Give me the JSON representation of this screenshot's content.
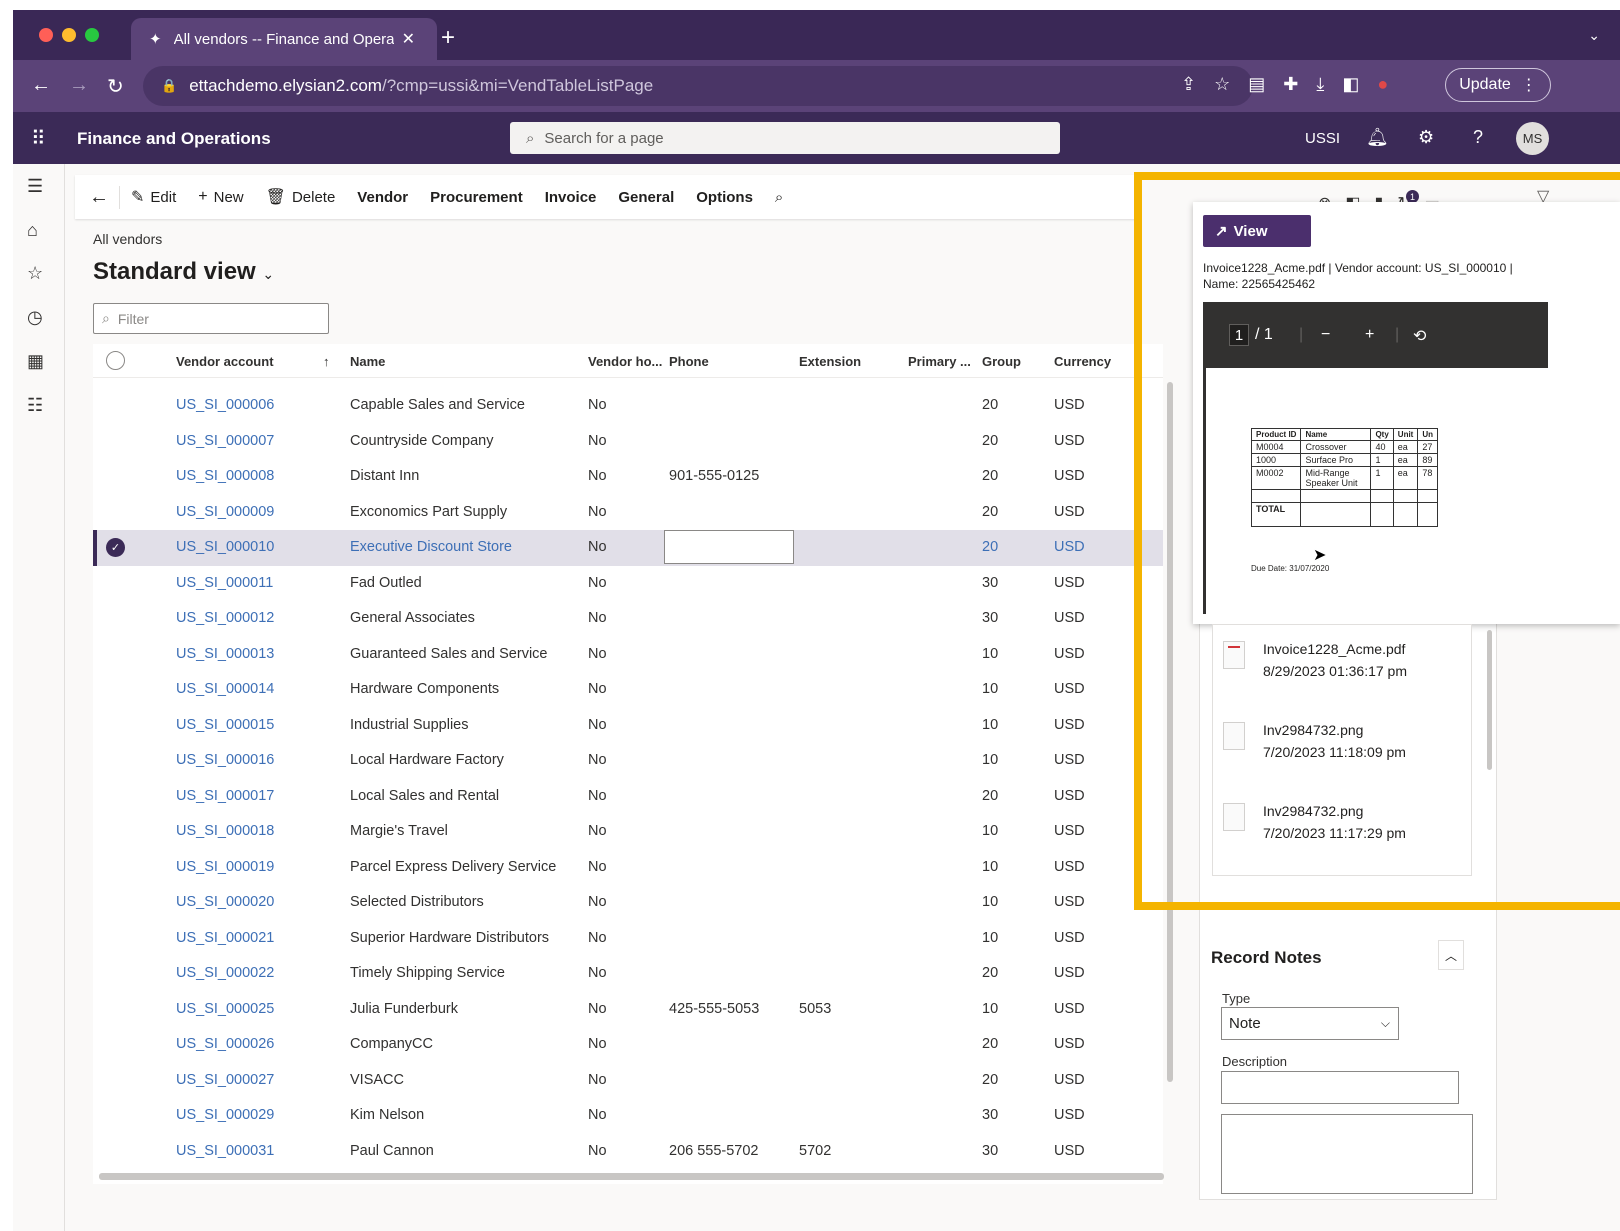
{
  "browser": {
    "tab_title": "All vendors -- Finance and Operations",
    "url_host": "ettachdemo.elysian2.com",
    "url_path": "/?cmp=ussi&mi=VendTableListPage",
    "update_label": "Update"
  },
  "appbar": {
    "title": "Finance and Operations",
    "search_placeholder": "Search for a page",
    "company": "USSI",
    "avatar_initials": "MS"
  },
  "actionpane": {
    "edit": "Edit",
    "new": "New",
    "delete": "Delete",
    "vendor": "Vendor",
    "procurement": "Procurement",
    "invoice": "Invoice",
    "general": "General",
    "options": "Options"
  },
  "page": {
    "breadcrumb": "All vendors",
    "title": "Standard view",
    "filter_placeholder": "Filter"
  },
  "grid": {
    "headers": {
      "account": "Vendor account",
      "name": "Name",
      "hold": "Vendor ho...",
      "phone": "Phone",
      "extension": "Extension",
      "primary": "Primary ...",
      "group": "Group",
      "currency": "Currency"
    },
    "rows": [
      {
        "account": "US_SI_000006",
        "name": "Capable Sales and Service",
        "hold": "No",
        "phone": "",
        "ext": "",
        "group": "20",
        "currency": "USD"
      },
      {
        "account": "US_SI_000007",
        "name": "Countryside Company",
        "hold": "No",
        "phone": "",
        "ext": "",
        "group": "20",
        "currency": "USD"
      },
      {
        "account": "US_SI_000008",
        "name": "Distant Inn",
        "hold": "No",
        "phone": "901-555-0125",
        "ext": "",
        "group": "20",
        "currency": "USD"
      },
      {
        "account": "US_SI_000009",
        "name": "Exconomics Part Supply",
        "hold": "No",
        "phone": "",
        "ext": "",
        "group": "20",
        "currency": "USD"
      },
      {
        "account": "US_SI_000010",
        "name": "Executive Discount Store",
        "hold": "No",
        "phone": "",
        "ext": "",
        "group": "20",
        "currency": "USD"
      },
      {
        "account": "US_SI_000011",
        "name": "Fad Outled",
        "hold": "No",
        "phone": "",
        "ext": "",
        "group": "30",
        "currency": "USD"
      },
      {
        "account": "US_SI_000012",
        "name": "General Associates",
        "hold": "No",
        "phone": "",
        "ext": "",
        "group": "30",
        "currency": "USD"
      },
      {
        "account": "US_SI_000013",
        "name": "Guaranteed Sales and Service",
        "hold": "No",
        "phone": "",
        "ext": "",
        "group": "10",
        "currency": "USD"
      },
      {
        "account": "US_SI_000014",
        "name": "Hardware Components",
        "hold": "No",
        "phone": "",
        "ext": "",
        "group": "10",
        "currency": "USD"
      },
      {
        "account": "US_SI_000015",
        "name": "Industrial Supplies",
        "hold": "No",
        "phone": "",
        "ext": "",
        "group": "10",
        "currency": "USD"
      },
      {
        "account": "US_SI_000016",
        "name": "Local Hardware Factory",
        "hold": "No",
        "phone": "",
        "ext": "",
        "group": "10",
        "currency": "USD"
      },
      {
        "account": "US_SI_000017",
        "name": "Local Sales and Rental",
        "hold": "No",
        "phone": "",
        "ext": "",
        "group": "20",
        "currency": "USD"
      },
      {
        "account": "US_SI_000018",
        "name": "Margie's Travel",
        "hold": "No",
        "phone": "",
        "ext": "",
        "group": "10",
        "currency": "USD"
      },
      {
        "account": "US_SI_000019",
        "name": "Parcel Express Delivery Service",
        "hold": "No",
        "phone": "",
        "ext": "",
        "group": "10",
        "currency": "USD"
      },
      {
        "account": "US_SI_000020",
        "name": "Selected Distributors",
        "hold": "No",
        "phone": "",
        "ext": "",
        "group": "10",
        "currency": "USD"
      },
      {
        "account": "US_SI_000021",
        "name": "Superior Hardware Distributors",
        "hold": "No",
        "phone": "",
        "ext": "",
        "group": "10",
        "currency": "USD"
      },
      {
        "account": "US_SI_000022",
        "name": "Timely Shipping Service",
        "hold": "No",
        "phone": "",
        "ext": "",
        "group": "20",
        "currency": "USD"
      },
      {
        "account": "US_SI_000025",
        "name": "Julia Funderburk",
        "hold": "No",
        "phone": "425-555-5053",
        "ext": "5053",
        "group": "10",
        "currency": "USD"
      },
      {
        "account": "US_SI_000026",
        "name": "CompanyCC",
        "hold": "No",
        "phone": "",
        "ext": "",
        "group": "20",
        "currency": "USD"
      },
      {
        "account": "US_SI_000027",
        "name": "VISACC",
        "hold": "No",
        "phone": "",
        "ext": "",
        "group": "20",
        "currency": "USD"
      },
      {
        "account": "US_SI_000029",
        "name": "Kim Nelson",
        "hold": "No",
        "phone": "",
        "ext": "",
        "group": "30",
        "currency": "USD"
      },
      {
        "account": "US_SI_000031",
        "name": "Paul Cannon",
        "hold": "No",
        "phone": "206 555-5702",
        "ext": "5702",
        "group": "30",
        "currency": "USD"
      }
    ],
    "selected_row_index": 4
  },
  "viewer": {
    "view_label": "View",
    "caption": "Invoice1228_Acme.pdf | Vendor account: US_SI_000010 | Name: 22565425462",
    "page_current": "1",
    "page_total": "/ 1",
    "notification_count": "1",
    "pdf_headers": [
      "Product ID",
      "Name",
      "Qty",
      "Unit",
      "Un"
    ],
    "pdf_rows": [
      [
        "M0004",
        "Crossover",
        "40",
        "ea",
        "27"
      ],
      [
        "1000",
        "Surface Pro",
        "1",
        "ea",
        "89"
      ],
      [
        "M0002",
        "Mid-Range Speaker Unit",
        "1",
        "ea",
        "78"
      ]
    ],
    "pdf_total": "TOTAL",
    "pdf_due": "Due Date: 31/07/2020"
  },
  "attachments": [
    {
      "name": "Invoice1228_Acme.pdf",
      "date": "8/29/2023 01:36:17 pm",
      "icon": "pdf-file-icon"
    },
    {
      "name": "Inv2984732.png",
      "date": "7/20/2023 11:18:09 pm",
      "icon": "image-file-icon"
    },
    {
      "name": "Inv2984732.png",
      "date": "7/20/2023 11:17:29 pm",
      "icon": "image-file-icon"
    }
  ],
  "notes": {
    "title": "Record Notes",
    "type_label": "Type",
    "type_value": "Note",
    "description_label": "Description"
  },
  "colors": {
    "brand": "#3b2a57",
    "link": "#3d6fb6",
    "highlight": "#f4b400",
    "selected_row": "#e1dfe8"
  }
}
